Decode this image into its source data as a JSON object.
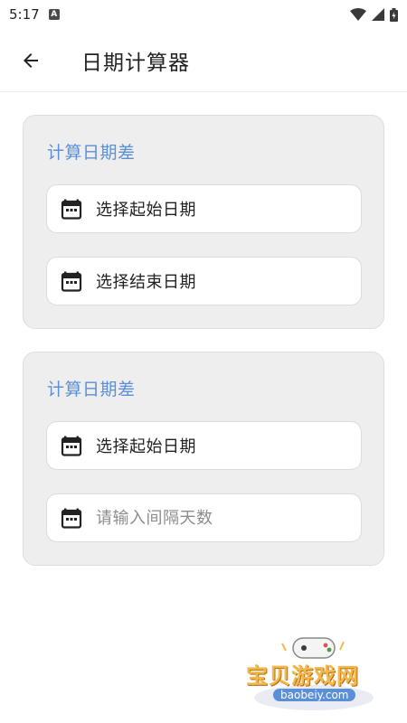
{
  "status_bar": {
    "time": "5:17",
    "notification_letter": "A"
  },
  "app_bar": {
    "title": "日期计算器"
  },
  "cards": [
    {
      "title": "计算日期差",
      "start_label": "选择起始日期",
      "end_label": "选择结束日期"
    },
    {
      "title": "计算日期差",
      "start_label": "选择起始日期",
      "days_placeholder": "请输入间隔天数"
    }
  ],
  "watermark": {
    "text": "宝贝游戏网",
    "site": "baobeiy.com"
  },
  "colors": {
    "accent": "#5b8fd8",
    "card_bg": "#eeeeee",
    "field_bg": "#ffffff"
  }
}
